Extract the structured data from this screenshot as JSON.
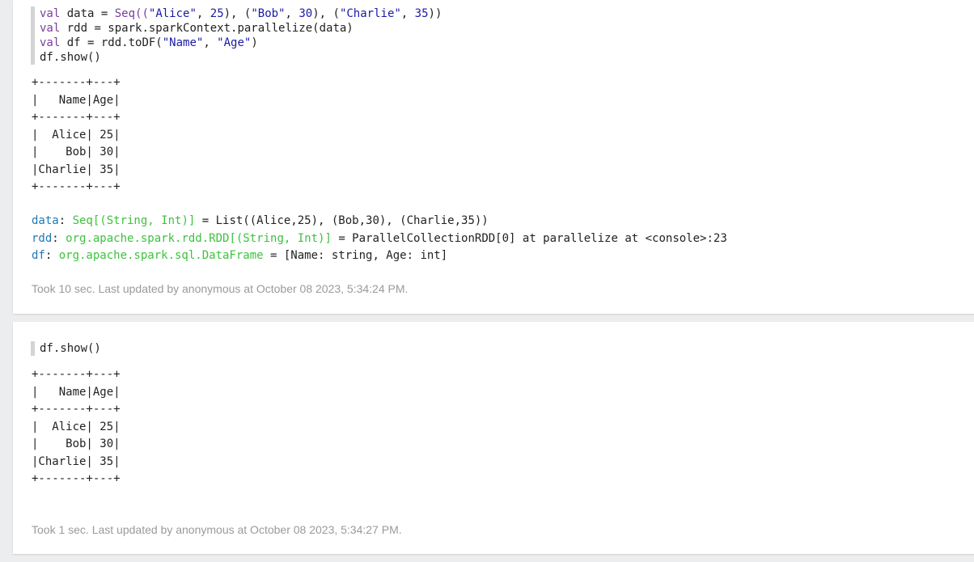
{
  "paragraph1": {
    "code": {
      "line1": {
        "kw": "val",
        "rest_a": " data = ",
        "seq": "Seq((",
        "s1": "\"Alice\"",
        "c1": ", ",
        "n1": "25",
        "c2": "), (",
        "s2": "\"Bob\"",
        "c3": ", ",
        "n2": "30",
        "c4": "), (",
        "s3": "\"Charlie\"",
        "c5": ", ",
        "n3": "35",
        "end": "))"
      },
      "line2": {
        "kw": "val",
        "rest": " rdd = spark.sparkContext.parallelize(data)"
      },
      "line3": {
        "kw": "val",
        "rest_a": " df = rdd.toDF(",
        "s1": "\"Name\"",
        "c1": ", ",
        "s2": "\"Age\"",
        "end": ")"
      },
      "line4": "df.show()"
    },
    "table_lines": [
      "+-------+---+",
      "|   Name|Age|",
      "+-------+---+",
      "|  Alice| 25|",
      "|    Bob| 30|",
      "|Charlie| 35|",
      "+-------+---+"
    ],
    "results": [
      {
        "name": "data",
        "sep": ": ",
        "type": "Seq[(String, Int)]",
        "value": " = List((Alice,25), (Bob,30), (Charlie,35))"
      },
      {
        "name": "rdd",
        "sep": ": ",
        "type": "org.apache.spark.rdd.RDD[(String, Int)]",
        "value": " = ParallelCollectionRDD[0] at parallelize at <console>:23"
      },
      {
        "name": "df",
        "sep": ": ",
        "type": "org.apache.spark.sql.DataFrame",
        "value": " = [Name: string, Age: int]"
      }
    ],
    "footer": "Took 10 sec. Last updated by anonymous at October 08 2023, 5:34:24 PM."
  },
  "paragraph2": {
    "code": {
      "line1": "df.show()"
    },
    "table_lines": [
      "+-------+---+",
      "|   Name|Age|",
      "+-------+---+",
      "|  Alice| 25|",
      "|    Bob| 30|",
      "|Charlie| 35|",
      "+-------+---+"
    ],
    "footer": "Took 1 sec. Last updated by anonymous at October 08 2023, 5:34:27 PM."
  },
  "colors": {
    "keyword": "#7a3e9d",
    "string": "#1a1aa6",
    "result_name": "#1f78b4",
    "result_type": "#3ec23e",
    "footer": "#9a9a9a"
  }
}
